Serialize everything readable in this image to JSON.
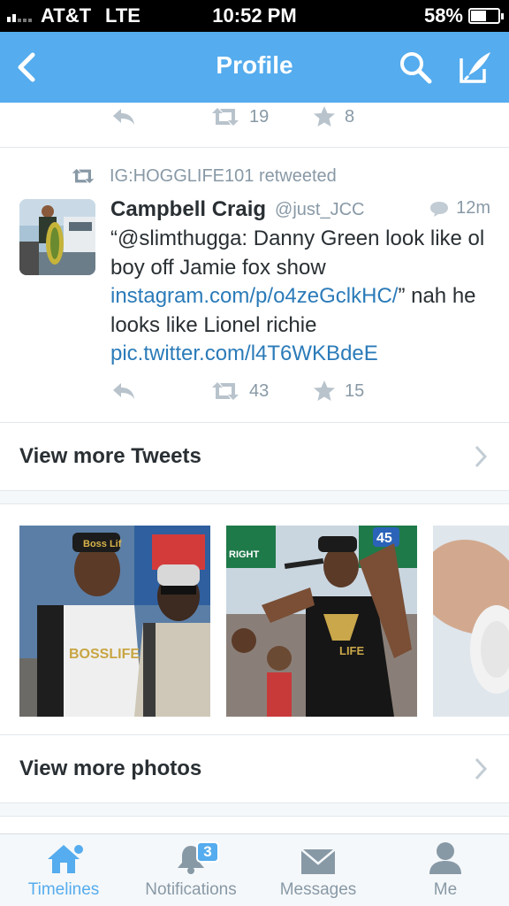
{
  "status_bar": {
    "carrier": "AT&T",
    "network": "LTE",
    "time": "10:52 PM",
    "battery_percent": "58%",
    "battery_level": 0.58
  },
  "nav": {
    "title": "Profile",
    "back_icon": "chevron-left-icon",
    "search_icon": "search-icon",
    "compose_icon": "compose-icon"
  },
  "prev_tweet_actions": {
    "retweets": "19",
    "favorites": "8"
  },
  "tweet": {
    "retweeted_by": "IG:HOGGLIFE101 retweeted",
    "name": "Campbell Craig",
    "handle": "@just_JCC",
    "time": "12m",
    "text_part1": "“@slimthugga: Danny Green look like ol boy off Jamie fox show ",
    "link1": "instagram.com/p/o4zeGclkHC/",
    "text_part2": "” nah he looks like Lionel richie ",
    "link2": "pic.twitter.com/l4T6WKBdeE",
    "retweets": "43",
    "favorites": "15"
  },
  "sections": {
    "view_more_tweets": "View more Tweets",
    "view_more_photos": "View more photos"
  },
  "photos": {
    "photo1_cap_text": "Boss Lif",
    "photo1_shirt_text": "BOSSLIFE",
    "photo2_sign_text": "45",
    "photo2_sign_label": "RIGHT",
    "photo2_shirt_text": "LIFE"
  },
  "tabs": [
    {
      "label": "Timelines",
      "icon": "home-icon",
      "active": true
    },
    {
      "label": "Notifications",
      "icon": "bell-icon",
      "badge": "3"
    },
    {
      "label": "Messages",
      "icon": "envelope-icon"
    },
    {
      "label": "Me",
      "icon": "person-icon"
    }
  ],
  "colors": {
    "brand": "#55acee",
    "link": "#2b7bb9",
    "muted": "#8899a6",
    "text": "#292f33"
  }
}
